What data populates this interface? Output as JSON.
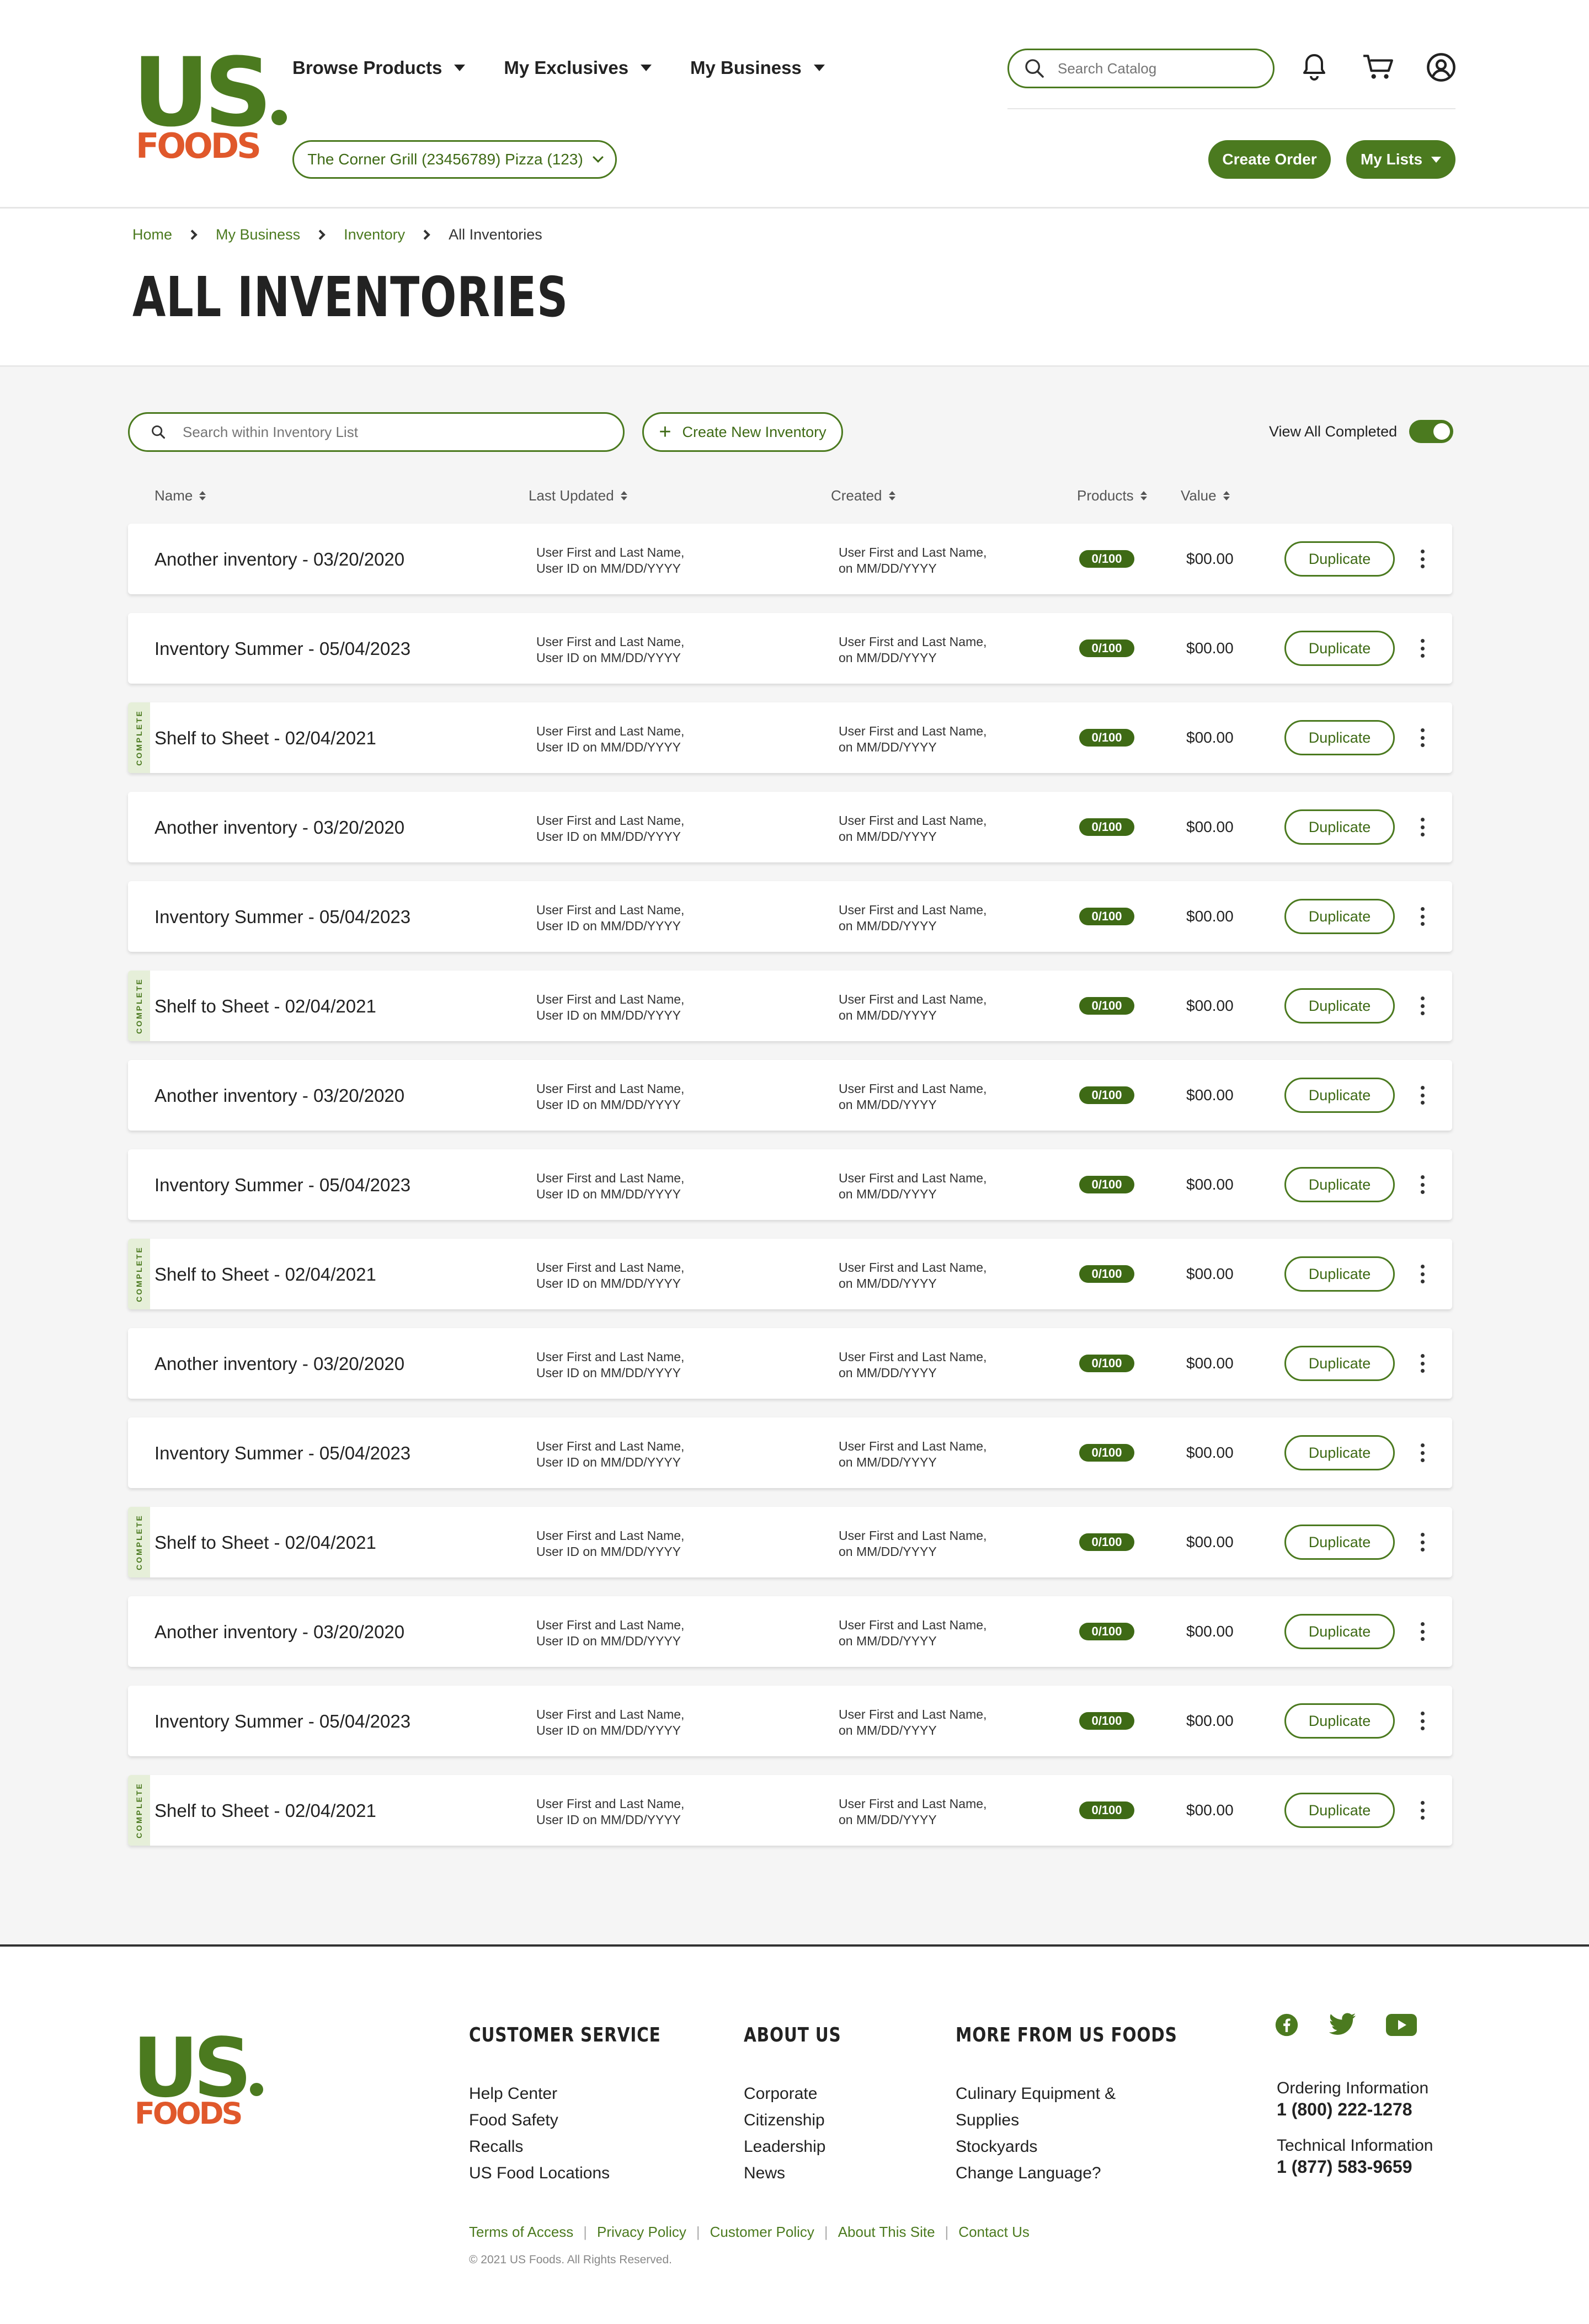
{
  "brand": {
    "logo_top": "US",
    "logo_bottom": "FOODS"
  },
  "header": {
    "nav": [
      {
        "label": "Browse Products"
      },
      {
        "label": "My Exclusives"
      },
      {
        "label": "My Business"
      }
    ],
    "search_placeholder": "Search Catalog",
    "location": "The Corner Grill (23456789) Pizza (123)",
    "create_order": "Create Order",
    "my_lists": "My Lists"
  },
  "breadcrumb": [
    "Home",
    "My Business",
    "Inventory",
    "All Inventories"
  ],
  "page_title": "ALL INVENTORIES",
  "toolbar": {
    "search_placeholder": "Search within Inventory List",
    "create_label": "Create New Inventory",
    "view_all_completed": "View All Completed",
    "view_all_completed_on": true
  },
  "columns": {
    "name": "Name",
    "last_updated": "Last Updated",
    "created": "Created",
    "products": "Products",
    "value": "Value"
  },
  "complete_label": "COMPLETE",
  "rows": [
    {
      "name": "Another inventory - 03/20/2020",
      "updated_1": "User First and Last Name,",
      "updated_2": "User ID on MM/DD/YYYY",
      "created_1": "User First and Last Name,",
      "created_2": "on MM/DD/YYYY",
      "products": "0/100",
      "value": "$00.00",
      "action": "Duplicate",
      "complete": false
    },
    {
      "name": "Inventory Summer - 05/04/2023",
      "updated_1": "User First and Last Name,",
      "updated_2": "User ID on MM/DD/YYYY",
      "created_1": "User First and Last Name,",
      "created_2": "on MM/DD/YYYY",
      "products": "0/100",
      "value": "$00.00",
      "action": "Duplicate",
      "complete": false
    },
    {
      "name": "Shelf to Sheet - 02/04/2021",
      "updated_1": "User First and Last Name,",
      "updated_2": "User ID on MM/DD/YYYY",
      "created_1": "User First and Last Name,",
      "created_2": "on MM/DD/YYYY",
      "products": "0/100",
      "value": "$00.00",
      "action": "Duplicate",
      "complete": true
    },
    {
      "name": "Another inventory - 03/20/2020",
      "updated_1": "User First and Last Name,",
      "updated_2": "User ID on MM/DD/YYYY",
      "created_1": "User First and Last Name,",
      "created_2": "on MM/DD/YYYY",
      "products": "0/100",
      "value": "$00.00",
      "action": "Duplicate",
      "complete": false
    },
    {
      "name": "Inventory Summer - 05/04/2023",
      "updated_1": "User First and Last Name,",
      "updated_2": "User ID on MM/DD/YYYY",
      "created_1": "User First and Last Name,",
      "created_2": "on MM/DD/YYYY",
      "products": "0/100",
      "value": "$00.00",
      "action": "Duplicate",
      "complete": false
    },
    {
      "name": "Shelf to Sheet - 02/04/2021",
      "updated_1": "User First and Last Name,",
      "updated_2": "User ID on MM/DD/YYYY",
      "created_1": "User First and Last Name,",
      "created_2": "on MM/DD/YYYY",
      "products": "0/100",
      "value": "$00.00",
      "action": "Duplicate",
      "complete": true
    },
    {
      "name": "Another inventory - 03/20/2020",
      "updated_1": "User First and Last Name,",
      "updated_2": "User ID on MM/DD/YYYY",
      "created_1": "User First and Last Name,",
      "created_2": "on MM/DD/YYYY",
      "products": "0/100",
      "value": "$00.00",
      "action": "Duplicate",
      "complete": false
    },
    {
      "name": "Inventory Summer - 05/04/2023",
      "updated_1": "User First and Last Name,",
      "updated_2": "User ID on MM/DD/YYYY",
      "created_1": "User First and Last Name,",
      "created_2": "on MM/DD/YYYY",
      "products": "0/100",
      "value": "$00.00",
      "action": "Duplicate",
      "complete": false
    },
    {
      "name": "Shelf to Sheet - 02/04/2021",
      "updated_1": "User First and Last Name,",
      "updated_2": "User ID on MM/DD/YYYY",
      "created_1": "User First and Last Name,",
      "created_2": "on MM/DD/YYYY",
      "products": "0/100",
      "value": "$00.00",
      "action": "Duplicate",
      "complete": true
    },
    {
      "name": "Another inventory - 03/20/2020",
      "updated_1": "User First and Last Name,",
      "updated_2": "User ID on MM/DD/YYYY",
      "created_1": "User First and Last Name,",
      "created_2": "on MM/DD/YYYY",
      "products": "0/100",
      "value": "$00.00",
      "action": "Duplicate",
      "complete": false
    },
    {
      "name": "Inventory Summer - 05/04/2023",
      "updated_1": "User First and Last Name,",
      "updated_2": "User ID on MM/DD/YYYY",
      "created_1": "User First and Last Name,",
      "created_2": "on MM/DD/YYYY",
      "products": "0/100",
      "value": "$00.00",
      "action": "Duplicate",
      "complete": false
    },
    {
      "name": "Shelf to Sheet - 02/04/2021",
      "updated_1": "User First and Last Name,",
      "updated_2": "User ID on MM/DD/YYYY",
      "created_1": "User First and Last Name,",
      "created_2": "on MM/DD/YYYY",
      "products": "0/100",
      "value": "$00.00",
      "action": "Duplicate",
      "complete": true
    },
    {
      "name": "Another inventory - 03/20/2020",
      "updated_1": "User First and Last Name,",
      "updated_2": "User ID on MM/DD/YYYY",
      "created_1": "User First and Last Name,",
      "created_2": "on MM/DD/YYYY",
      "products": "0/100",
      "value": "$00.00",
      "action": "Duplicate",
      "complete": false
    },
    {
      "name": "Inventory Summer - 05/04/2023",
      "updated_1": "User First and Last Name,",
      "updated_2": "User ID on MM/DD/YYYY",
      "created_1": "User First and Last Name,",
      "created_2": "on MM/DD/YYYY",
      "products": "0/100",
      "value": "$00.00",
      "action": "Duplicate",
      "complete": false
    },
    {
      "name": "Shelf to Sheet - 02/04/2021",
      "updated_1": "User First and Last Name,",
      "updated_2": "User ID on MM/DD/YYYY",
      "created_1": "User First and Last Name,",
      "created_2": "on MM/DD/YYYY",
      "products": "0/100",
      "value": "$00.00",
      "action": "Duplicate",
      "complete": true
    }
  ],
  "footer": {
    "customer_service": {
      "title": "CUSTOMER SERVICE",
      "links": [
        "Help Center",
        "Food Safety",
        "Recalls",
        "US Food Locations"
      ]
    },
    "about_us": {
      "title": "ABOUT US",
      "links": [
        "Corporate",
        "Citizenship",
        "Leadership",
        "News"
      ]
    },
    "more": {
      "title": "MORE FROM US FOODS",
      "links": [
        "Culinary Equipment &",
        "Supplies",
        "Stockyards",
        "Change Language?"
      ]
    },
    "social_icons": [
      "facebook-icon",
      "twitter-icon",
      "youtube-icon"
    ],
    "ordering_label": "Ordering Information",
    "ordering_number": "1 (800) 222-1278",
    "technical_label": "Technical Information",
    "technical_number": "1 (877) 583-9659",
    "legal_links": [
      "Terms of Access",
      "Privacy Policy",
      "Customer Policy",
      "About This Site",
      "Contact Us"
    ],
    "copyright": "© 2021 US Foods. All Rights Reserved."
  },
  "colors": {
    "brand_green": "#4b7a1f",
    "brand_orange": "#e0582b",
    "complete_tint": "#e6efd9"
  }
}
